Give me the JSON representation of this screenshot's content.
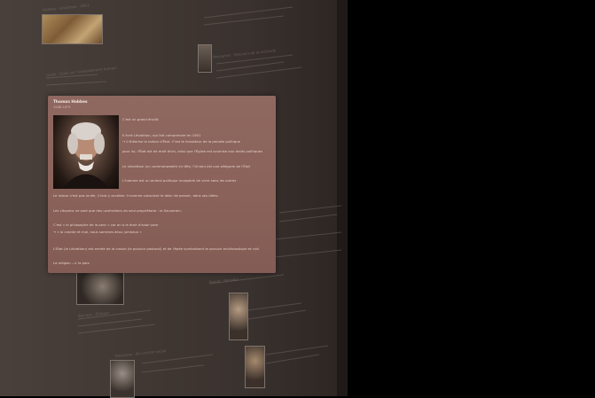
{
  "card": {
    "name": "Thomas Hobbes",
    "dates": "1588-1679",
    "lines_right": [
      "C'est un grand érudit.",
      "Il écrit Léviathan, qui fait comprendre en 1651",
      "→ il théorise la notion d'État. C'est le fondateur de la pensée politique",
      "pour lui, l'État est de droit divin, ainsi que l'Église est soumise aux droits politiques",
      "Le Léviathan (un commonwealth en tête, l'Union) est une allégorie de l'État",
      "L'homme est un animal politique incapable de vivre sans les autres"
    ],
    "lines_full": [
      "Le raison n'est pas innée, il faut y accéder. Il nomme conscient le désir de penser, dans ses idées.",
      "Les citoyens ne sont que des usufruitiers du seul propriétaire : le Souverain.",
      "C'est « le philosophe de la peur » car on a le droit d'avoir peur",
      "→ « la crainte et moi, nous sommes deux jumeaux »",
      "L'État (le Léviathan) est armée de la crosse (le pouvoir pastoral) et de l'épée symbolisent le pouvoir ecclésiastique et civil",
      "La religion --> la paix"
    ]
  },
  "background": {
    "text_blocks": [
      "Hobbes · Léviathan · 1651",
      "Descartes · Discours de la méthode",
      "Locke · Essai sur l'entendement humain",
      "Spinoza · Éthique",
      "Pascal · Pensées",
      "Rousseau · Du contrat social"
    ]
  },
  "colors": {
    "card_bg": "#8a6259",
    "wall": "#3f3733",
    "outside": "#000000"
  }
}
